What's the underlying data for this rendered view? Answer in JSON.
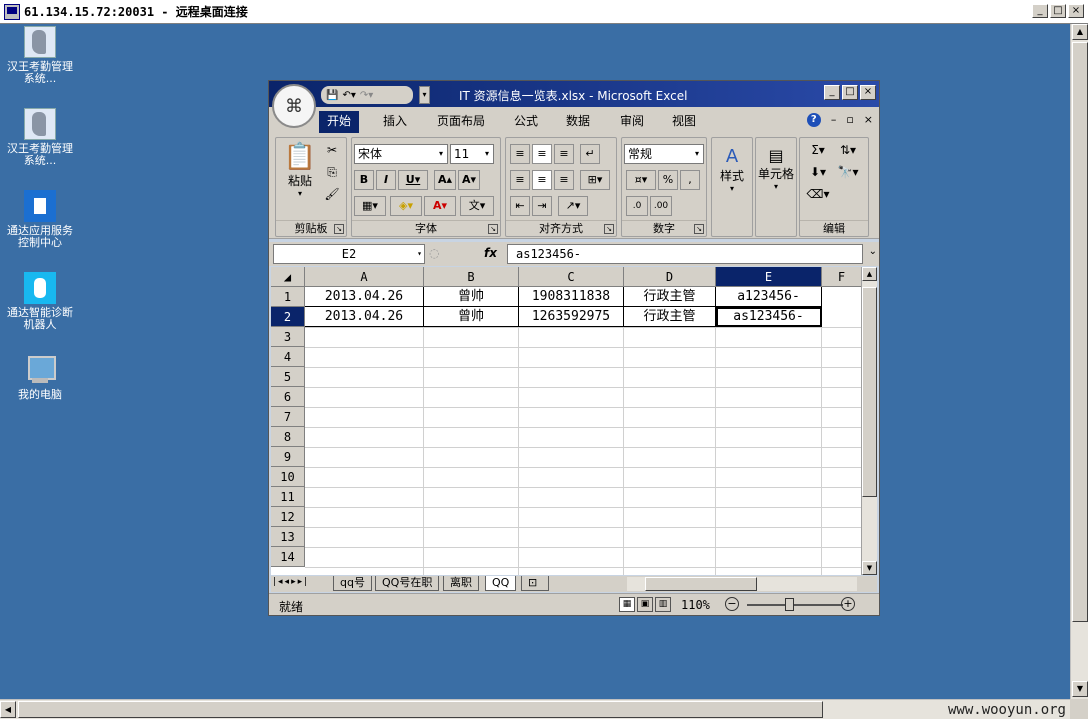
{
  "rdp": {
    "title": "61.134.15.72:20031 - 远程桌面连接",
    "watermark": "www.wooyun.org"
  },
  "desktop": {
    "icons": [
      {
        "label": "汉王考勤管理系统...",
        "icon": "attendance-app-icon"
      },
      {
        "label": "汉王考勤管理系统...",
        "icon": "attendance-app-icon"
      },
      {
        "label": "通达应用服务控制中心",
        "icon": "service-control-icon"
      },
      {
        "label": "通达智能诊断机器人",
        "icon": "robot-icon"
      },
      {
        "label": "我的电脑",
        "icon": "computer-icon"
      }
    ]
  },
  "excel": {
    "title": "IT 资源信息一览表.xlsx - Microsoft Excel",
    "tabs": [
      "开始",
      "插入",
      "页面布局",
      "公式",
      "数据",
      "审阅",
      "视图"
    ],
    "active_tab": "开始",
    "ribbon": {
      "clipboard": {
        "paste": "粘贴",
        "label": "剪贴板"
      },
      "font": {
        "name": "宋体",
        "size": "11",
        "label": "字体"
      },
      "alignment": {
        "label": "对齐方式"
      },
      "number": {
        "format": "常规",
        "label": "数字"
      },
      "styles": {
        "label": "样式"
      },
      "cells": {
        "label": "单元格"
      },
      "editing": {
        "label": "编辑"
      }
    },
    "formula_bar": {
      "name_box": "E2",
      "fx": "fx",
      "value": "as123456-"
    },
    "columns": [
      "A",
      "B",
      "C",
      "D",
      "E",
      "F"
    ],
    "selected_column": "E",
    "rows": [
      [
        "2013.04.26",
        "曾帅",
        "1908311838",
        "行政主管",
        "a123456-"
      ],
      [
        "2013.04.26",
        "曾帅",
        "1263592975",
        "行政主管",
        "as123456-"
      ]
    ],
    "row_numbers": [
      "1",
      "2",
      "3",
      "4",
      "5",
      "6",
      "7",
      "8",
      "9",
      "10",
      "11",
      "12",
      "13",
      "14"
    ],
    "selected_row": "2",
    "sheets": [
      "qq号",
      "QQ号在职",
      "离职",
      "QQ"
    ],
    "active_sheet": "QQ",
    "status": {
      "text": "就绪",
      "zoom": "110%"
    }
  }
}
